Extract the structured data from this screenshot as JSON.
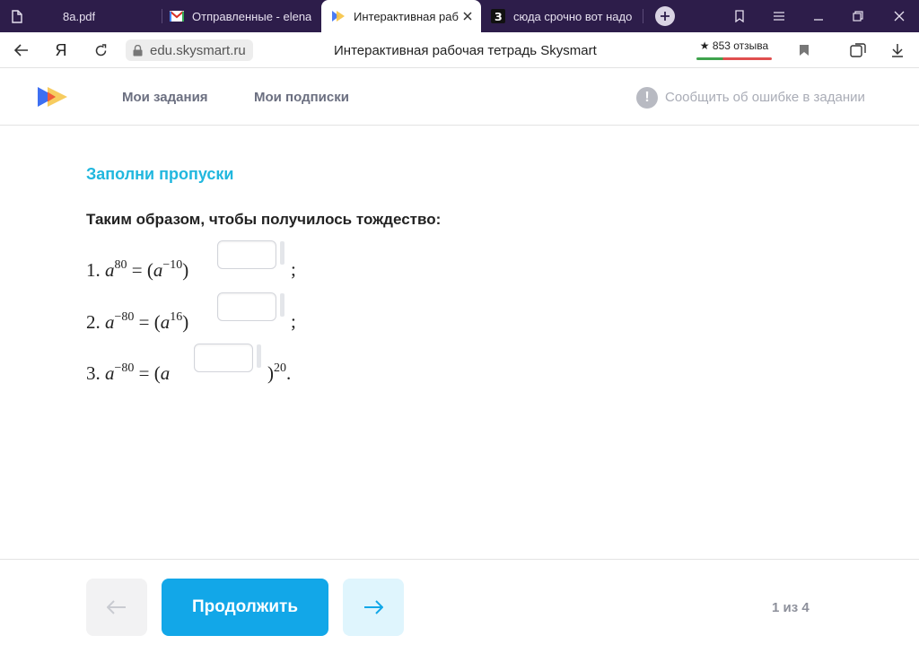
{
  "browser": {
    "tabs": [
      {
        "label": "8a.pdf",
        "icon": "document-icon"
      },
      {
        "label": "Отправленные - elena",
        "icon": "gmail-icon"
      },
      {
        "label": "Интерактивная раб",
        "icon": "skysmart-icon"
      },
      {
        "label": "сюда срочно вот надо",
        "icon": "znanija-icon"
      }
    ],
    "url": "edu.skysmart.ru",
    "page_title": "Интерактивная рабочая тетрадь Skysmart",
    "reviews": "★ 853 отзыва",
    "yandex_letter": "Я"
  },
  "header": {
    "nav": [
      "Мои задания",
      "Мои подписки"
    ],
    "report_error": "Сообщить об ошибке в задании"
  },
  "task": {
    "title": "Заполни пропуски",
    "instruction": "Таким образом, чтобы получилось тождество:",
    "equations": [
      {
        "number": "1.",
        "base": "a",
        "lhs_exp": "80",
        "rhs_open": "(",
        "rhs_base": "a",
        "rhs_inner_exp": "−10",
        "rhs_close": ")",
        "end": ";"
      },
      {
        "number": "2.",
        "base": "a",
        "lhs_exp": "−80",
        "rhs_open": "(",
        "rhs_base": "a",
        "rhs_inner_exp": "16",
        "rhs_close": ")",
        "end": ";"
      },
      {
        "number": "3.",
        "base": "a",
        "lhs_exp": "−80",
        "rhs_open": "(",
        "rhs_base": "a",
        "rhs_close": ")",
        "outer_exp": "20",
        "end": "."
      }
    ],
    "equals": "="
  },
  "footer": {
    "continue": "Продолжить",
    "pager": "1 из 4"
  },
  "colors": {
    "accent": "#12a7e8",
    "title": "#21b7de",
    "tabbar": "#2d1d4a"
  }
}
